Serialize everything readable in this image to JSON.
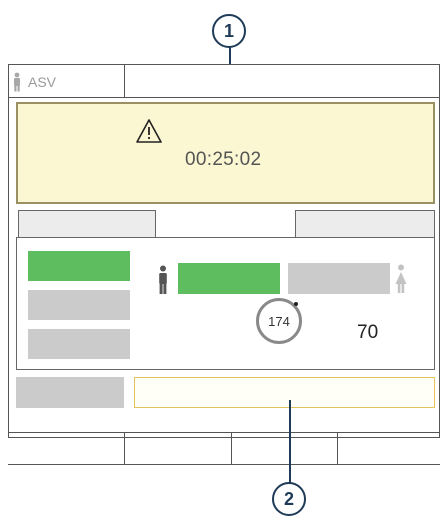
{
  "callouts": {
    "top_number": "1",
    "bottom_number": "2"
  },
  "header": {
    "mode_label": "ASV"
  },
  "alarm": {
    "time": "00:25:02"
  },
  "display": {
    "rate_value": "174",
    "numeric_value": "70"
  },
  "colors": {
    "green": "#5ebd5e",
    "alarm_bg": "#fbf7d2",
    "callout": "#1f3b57"
  },
  "icons": {
    "warning": "warning-triangle-icon",
    "male": "male-patient-icon",
    "female": "female-patient-icon"
  }
}
